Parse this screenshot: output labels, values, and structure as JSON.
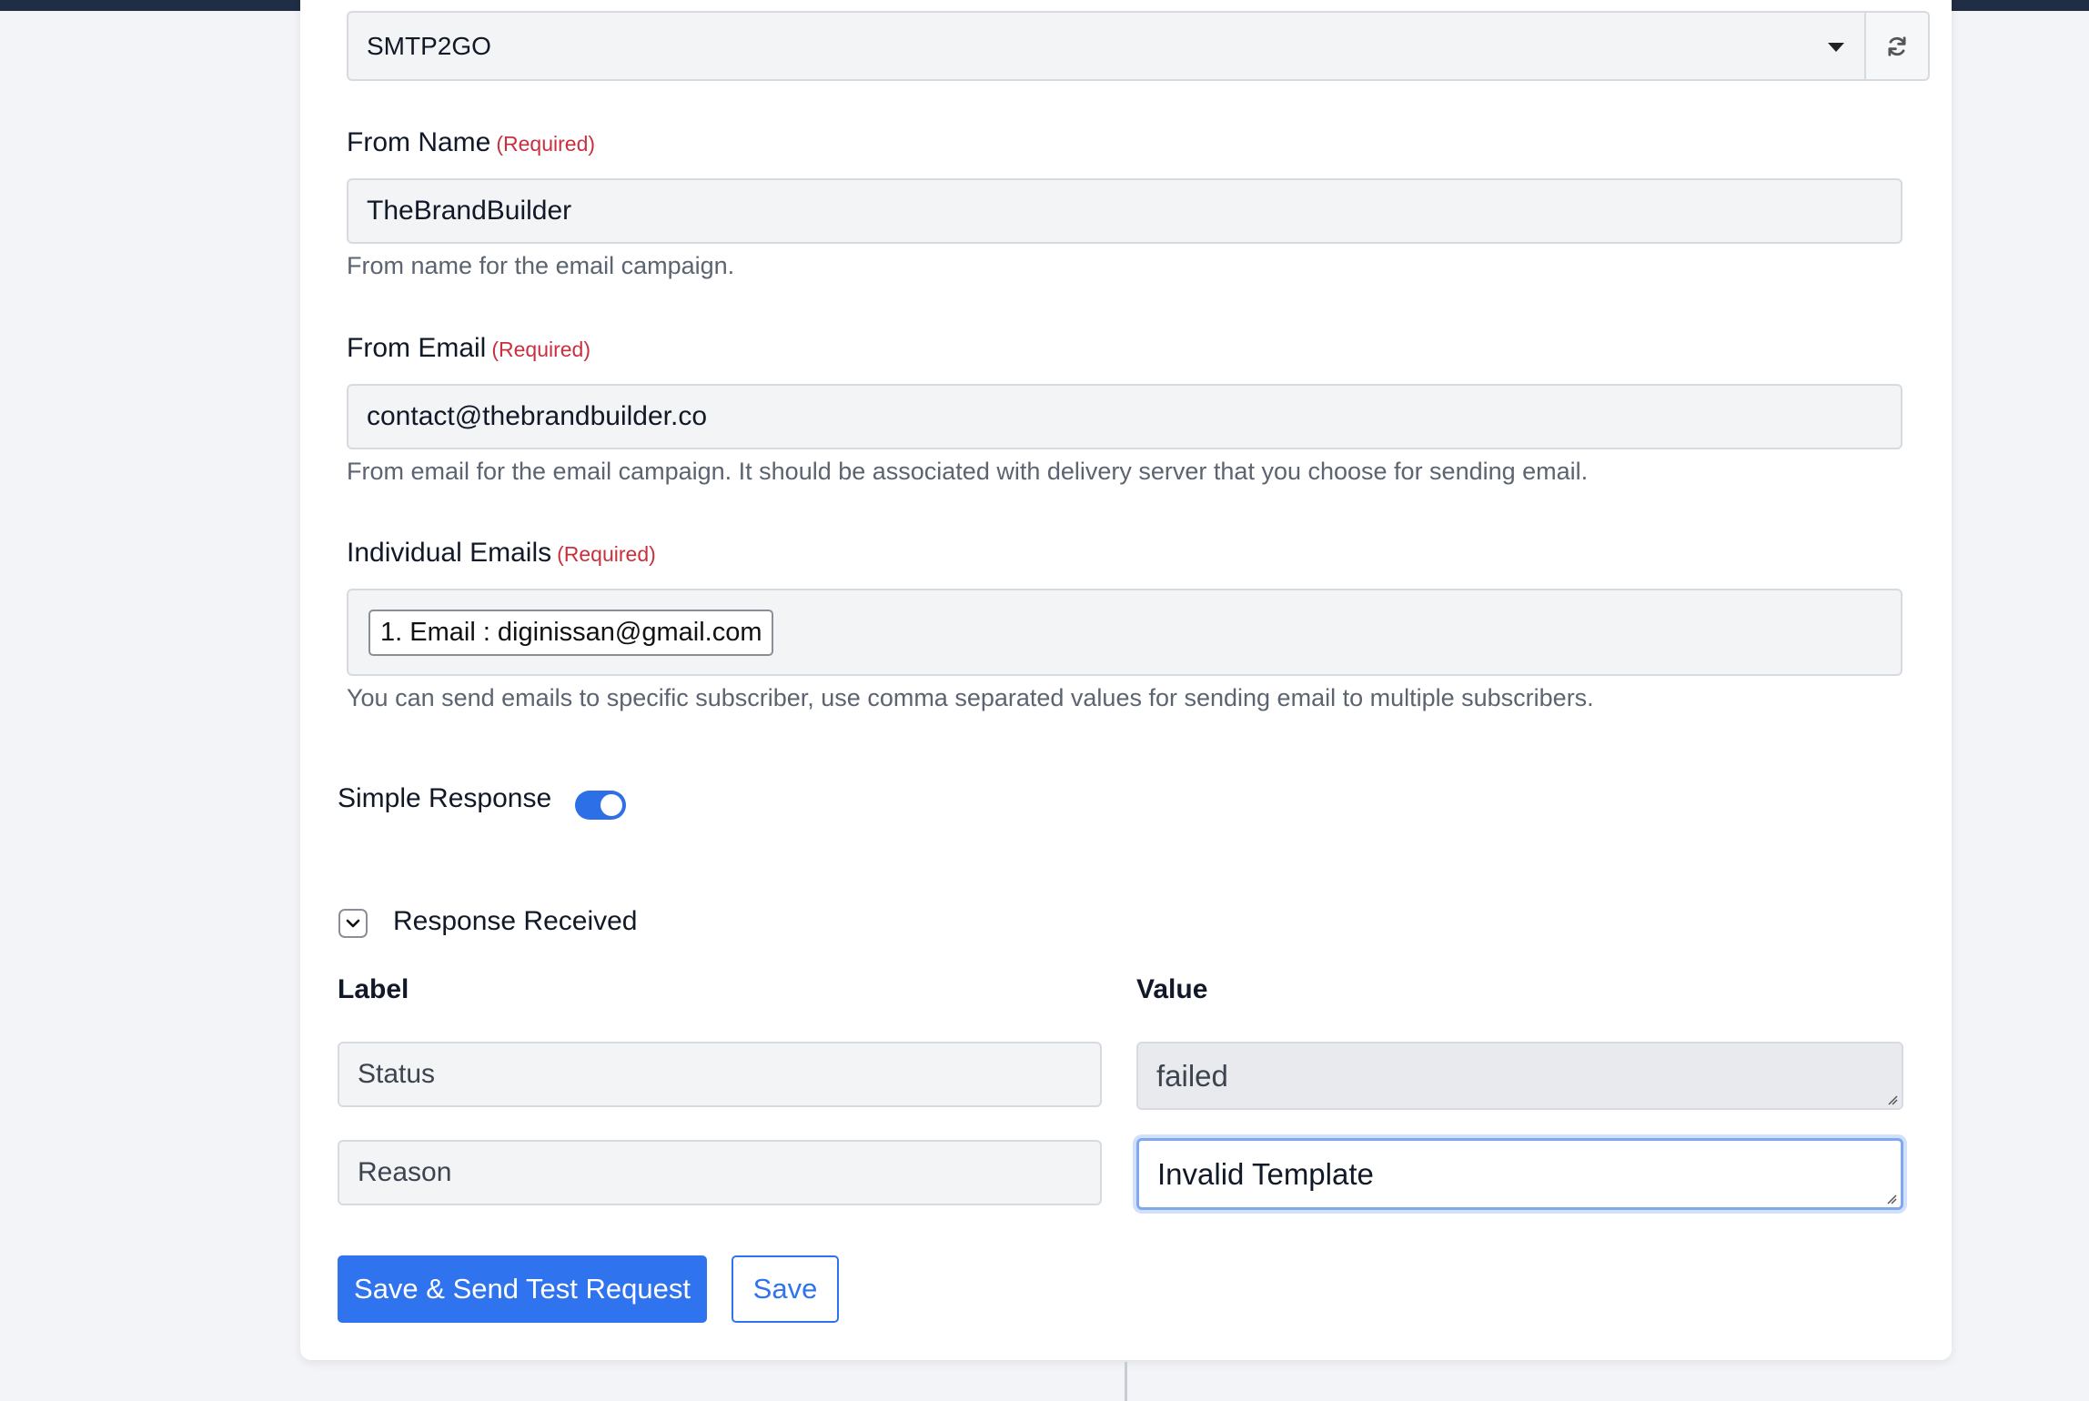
{
  "delivery_server": {
    "selected": "SMTP2GO",
    "refresh_icon": "refresh-icon",
    "caret_icon": "caret-down-icon"
  },
  "from_name": {
    "label": "From Name",
    "required": "(Required)",
    "value": "TheBrandBuilder",
    "help": "From name for the email campaign."
  },
  "from_email": {
    "label": "From Email",
    "required": "(Required)",
    "value": "contact@thebrandbuilder.co",
    "help": "From email for the email campaign. It should be associated with delivery server that you choose for sending email."
  },
  "individual_emails": {
    "label": "Individual Emails",
    "required": "(Required)",
    "tags": [
      "1. Email : diginissan@gmail.com"
    ],
    "help": "You can send emails to specific subscriber, use comma separated values for sending email to multiple subscribers."
  },
  "simple_response": {
    "label": "Simple Response",
    "enabled": true
  },
  "response_received": {
    "title": "Response Received",
    "expanded": true,
    "label_header": "Label",
    "value_header": "Value",
    "rows": [
      {
        "label": "Status",
        "value": "failed"
      },
      {
        "label": "Reason",
        "value": "Invalid Template"
      }
    ]
  },
  "actions": {
    "save_send_label": "Save & Send Test Request",
    "save_label": "Save"
  },
  "colors": {
    "primary": "#2f73ee",
    "required": "#c9303e",
    "topbar": "#1f2d45"
  }
}
